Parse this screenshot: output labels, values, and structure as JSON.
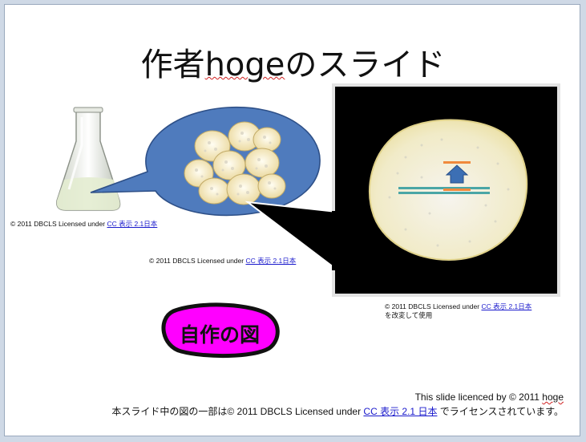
{
  "slide": {
    "title_prefix": "作者",
    "title_name": "hoge",
    "title_suffix": "のスライド",
    "credit_1": {
      "prefix": "© 2011 DBCLS  Licensed under ",
      "link": "CC 表示 2.1日本"
    },
    "credit_2": {
      "prefix": "© 2011 DBCLS  Licensed under ",
      "link": "CC 表示 2.1日本"
    },
    "credit_3": {
      "prefix": "© 2011 DBCLS  Licensed under ",
      "link": "CC 表示 2.1日本",
      "note": "を改変して使用"
    },
    "badge_text": "自作の図",
    "footer_line1_prefix": "This slide licenced by © 2011 ",
    "footer_line1_name": "hoge",
    "footer_line2_prefix": "本スライド中の図の一部は© 2011 DBCLS Licensed under ",
    "footer_line2_link": "CC 表示 2.1 日本",
    "footer_line2_suffix": " でライセンスされています。"
  },
  "colors": {
    "callout_blue": "#4f7bbd",
    "badge_magenta": "#ff00ff",
    "cell_fill": "#f4e7b8",
    "membrane_teal": "#4aa6a6",
    "marker_orange": "#f08a3c",
    "arrow_blue": "#3c6fb4"
  }
}
